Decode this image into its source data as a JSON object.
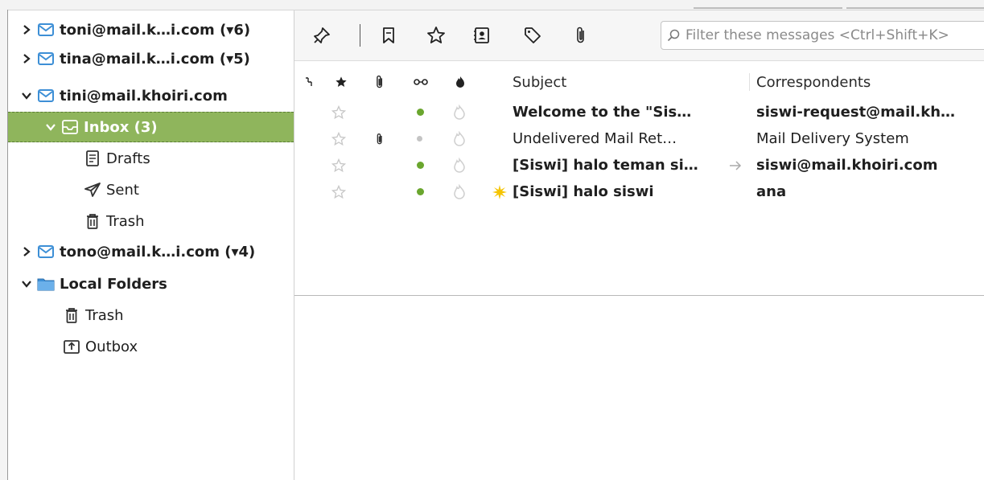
{
  "folders": {
    "accounts": [
      {
        "label": "toni@mail.k…i.com (▾6)",
        "expanded": false
      },
      {
        "label": "tina@mail.k…i.com (▾5)",
        "expanded": false
      },
      {
        "label": "tini@mail.khoiri.com",
        "expanded": true
      }
    ],
    "inbox": "Inbox (3)",
    "drafts": "Drafts",
    "sent": "Sent",
    "trash": "Trash",
    "account4": "tono@mail.k…i.com (▾4)",
    "local_folders": "Local Folders",
    "local_trash": "Trash",
    "outbox": "Outbox"
  },
  "toolbar": {
    "icons": [
      "quick-filter-pin-icon",
      "bookmark-icon",
      "star-icon",
      "contact-icon",
      "tag-icon",
      "attachment-icon"
    ],
    "filter_placeholder": "Filter these messages <Ctrl+Shift+K>"
  },
  "columns": {
    "subject": "Subject",
    "correspondents": "Correspondents"
  },
  "messages": [
    {
      "subject": "Welcome to the \"Sis…",
      "correspondent": "siswi-request@mail.kh…",
      "unread": true,
      "attachment": false,
      "status": "green",
      "new": false,
      "replied": false
    },
    {
      "subject": "Undelivered Mail Ret…",
      "correspondent": "Mail Delivery System",
      "unread": false,
      "attachment": true,
      "status": "grey",
      "new": false,
      "replied": false
    },
    {
      "subject": "[Siswi] halo teman si…",
      "correspondent": "siswi@mail.khoiri.com",
      "unread": true,
      "attachment": false,
      "status": "green",
      "new": false,
      "replied": true
    },
    {
      "subject": "[Siswi] halo siswi",
      "correspondent": "ana",
      "unread": true,
      "attachment": false,
      "status": "green",
      "new": true,
      "replied": false
    }
  ],
  "colors": {
    "selection": "#8fb55c",
    "status_green": "#6aa62e",
    "status_grey": "#c4c4c4",
    "new_star": "#f5c400",
    "folder_blue": "#3d8fd6"
  }
}
